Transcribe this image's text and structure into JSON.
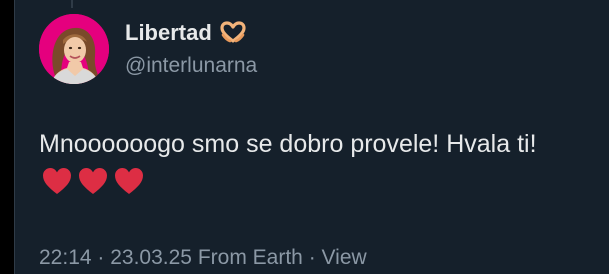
{
  "author": {
    "display_name": "Libertad",
    "name_emoji": "heart-hands-emoji",
    "handle": "@interlunarna",
    "avatar_bg": "#e5007e"
  },
  "tweet": {
    "text": "Mnoooooogo smo se dobro provele! Hvala ti!",
    "hearts": [
      "red-heart-emoji",
      "red-heart-emoji",
      "red-heart-emoji"
    ],
    "heart_color": "#dd2e44"
  },
  "meta": {
    "time": "22:14",
    "date": "23.03.25",
    "source": "From Earth",
    "view_label": "View",
    "separator": " · "
  },
  "colors": {
    "background": "#15202b",
    "primary_text": "#e7e9ea",
    "secondary_text": "#8b98a5"
  }
}
